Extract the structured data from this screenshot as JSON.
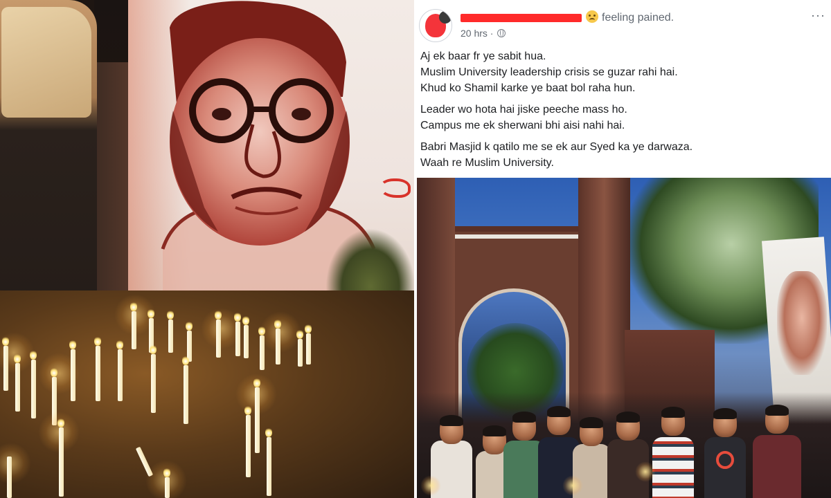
{
  "post": {
    "author_redacted": true,
    "feeling_text": "feeling pained.",
    "more_glyph": "···",
    "timestamp": "20 hrs",
    "separator": " · ",
    "privacy_icon": "globe-icon",
    "paragraphs": [
      {
        "lines": [
          "Aj ek baar fr ye sabit hua.",
          "Muslim University leadership crisis se guzar rahi hai.",
          "Khud ko Shamil karke ye baat bol raha hun."
        ]
      },
      {
        "lines": [
          "Leader wo hota hai jiske peeche mass ho.",
          "Campus me ek sherwani bhi aisi nahi hai."
        ]
      },
      {
        "lines": [
          "Babri Masjid k qatilo me se ek aur Syed ka ye darwaza.",
          "Waah re Muslim University."
        ]
      }
    ]
  },
  "colors": {
    "text_primary": "#1c1e21",
    "text_secondary": "#606770",
    "redaction": "#ff2a2a"
  },
  "photos": {
    "left": "candlelight-vigil-portrait-banner",
    "right": "university-gate-night-vigil-crowd"
  }
}
